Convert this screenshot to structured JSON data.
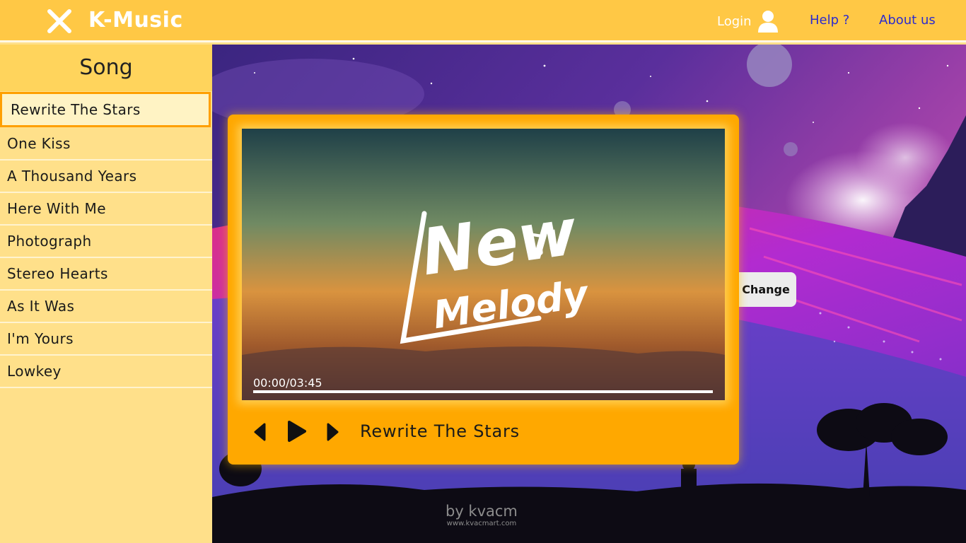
{
  "header": {
    "brand": "K-Music",
    "login_label": "Login",
    "help_label": "Help ?",
    "about_label": "About us"
  },
  "sidebar": {
    "title": "Song",
    "songs": [
      "Rewrite The Stars",
      "One Kiss",
      "A Thousand Years",
      "Here With Me",
      "Photograph",
      "Stereo Hearts",
      "As It Was",
      "I'm Yours",
      "Lowkey"
    ],
    "active_index": 0
  },
  "player": {
    "time": "00:00/03:45",
    "progress_fraction": 0,
    "now_playing": "Rewrite The Stars",
    "artwork_text_line1": "New",
    "artwork_text_line2": "Melody",
    "controls": [
      "prev-icon",
      "play-icon",
      "next-icon"
    ]
  },
  "change_label": "Change",
  "watermark": {
    "line1": "by kvacm",
    "line2": "www.kvacmart.com"
  },
  "colors": {
    "header": "#ffc845",
    "sidebar": "#ffe08a",
    "accent": "#ffa800",
    "link": "#2b2bcf"
  }
}
